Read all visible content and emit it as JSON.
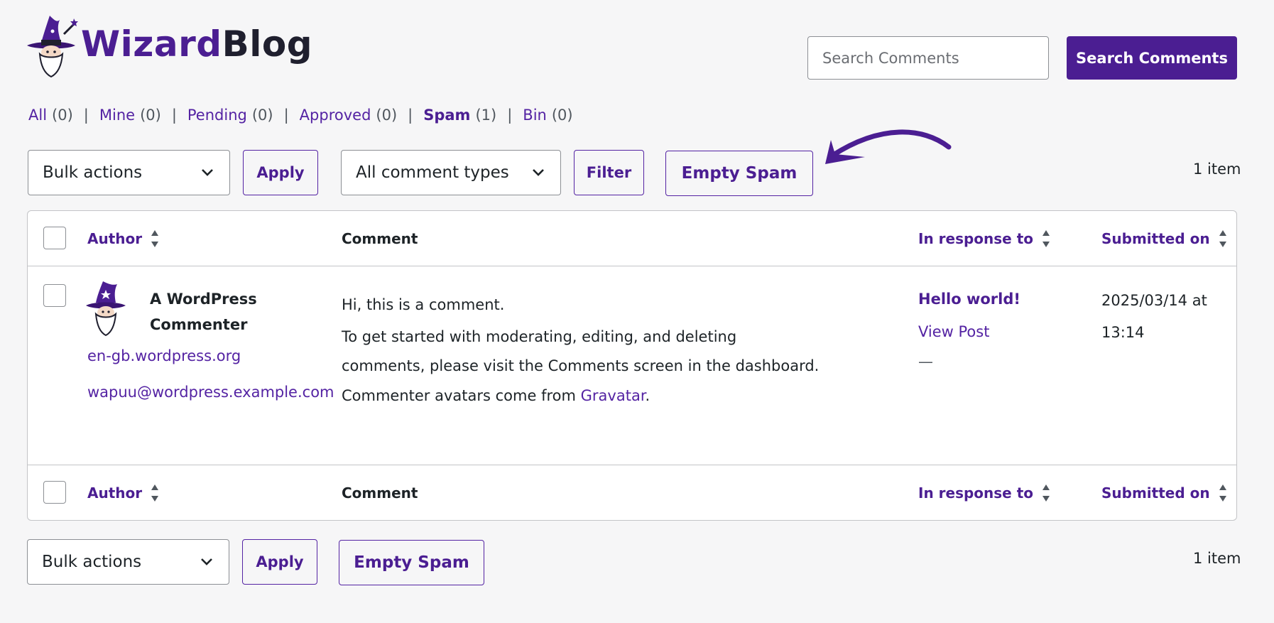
{
  "brand": {
    "name_part1": "Wizard",
    "name_part2": "Blog"
  },
  "search": {
    "placeholder": "Search Comments",
    "button_label": "Search Comments"
  },
  "views": [
    {
      "label": "All",
      "count": "(0)"
    },
    {
      "label": "Mine",
      "count": "(0)"
    },
    {
      "label": "Pending",
      "count": "(0)"
    },
    {
      "label": "Approved",
      "count": "(0)"
    },
    {
      "label": "Spam",
      "count": "(1)"
    },
    {
      "label": "Bin",
      "count": "(0)"
    }
  ],
  "separator": "|",
  "top_controls": {
    "bulk_actions": "Bulk actions",
    "apply": "Apply",
    "comment_types": "All comment types",
    "filter": "Filter",
    "empty_spam": "Empty Spam",
    "item_count": "1 item"
  },
  "table": {
    "columns": {
      "author": "Author",
      "comment": "Comment",
      "in_response_to": "In response to",
      "submitted_on": "Submitted on"
    },
    "rows": [
      {
        "author_name": "A WordPress Commenter",
        "author_url": "en-gb.wordpress.org",
        "author_email": "wapuu@wordpress.example.com",
        "comment_line1": "Hi, this is a comment.",
        "comment_line2": "To get started with moderating, editing, and deleting comments, please visit the Comments screen in the dashboard.",
        "comment_line3_prefix": "Commenter avatars come from ",
        "comment_line3_link": "Gravatar",
        "comment_line3_suffix": ".",
        "response_title": "Hello world!",
        "response_view": "View Post",
        "response_dash": "—",
        "submitted_on": "2025/03/14 at 13:14"
      }
    ]
  },
  "bottom_controls": {
    "bulk_actions": "Bulk actions",
    "apply": "Apply",
    "empty_spam": "Empty Spam",
    "item_count": "1 item"
  },
  "colors": {
    "accent": "#4b1e92",
    "link": "#5423a3",
    "border": "#c3c4c7"
  },
  "icons": {
    "logo": "wizard-logo-icon",
    "select": "chevron-down-icon",
    "sort": "sort-arrows-icon",
    "avatar": "wizard-avatar-icon",
    "annotation": "curved-arrow-icon"
  }
}
